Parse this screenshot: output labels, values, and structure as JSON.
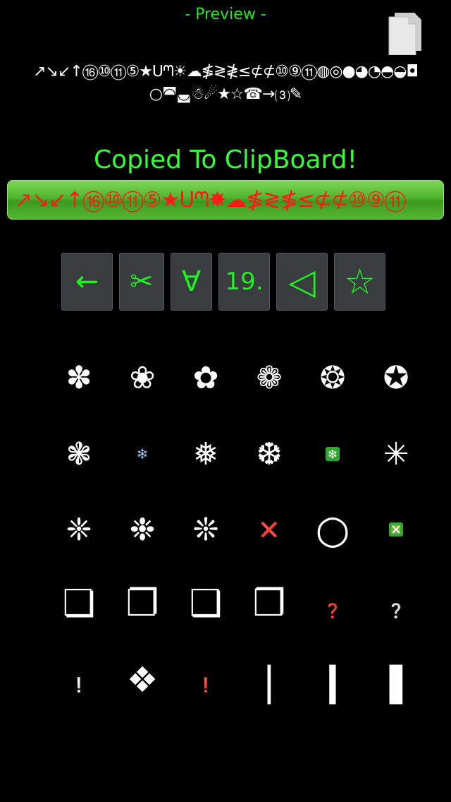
{
  "header": {
    "title": "- Preview -"
  },
  "preview": {
    "text": "↗↘↙↑⑯⑩⑪⑤★ᑌᘉ☀☁≸≷≹≤⊄⊄⑩⑨⑪◍◎●◕◔◓◒◘○◚◛☃☄★☆☎→⑶✎"
  },
  "status": {
    "copied": "Copied To ClipBoard!"
  },
  "output": {
    "text": "↗↘↙↑⑯⑩⑪⑤★ᑌᘉ✸☁≸≷≸≤⊄⊄⑩⑨⑪"
  },
  "toolbar": {
    "back": "←",
    "cut": "✂",
    "forall": "∀",
    "counter": "19.",
    "triangle": "◁",
    "star": "☆"
  },
  "symbols": [
    "✽",
    "❀",
    "✿",
    "❁",
    "❂",
    "✪",
    "❃",
    "❄",
    "❅",
    "❆",
    "❇",
    "✳",
    "❈",
    "❉",
    "❊",
    "❌",
    "○",
    "❎",
    "❏",
    "❐",
    "❑",
    "❒",
    "❓",
    "❔",
    "❕",
    "❖",
    "❗",
    "❘",
    "❙",
    "❚"
  ],
  "colors": {
    "accent": "#22e622",
    "output_text": "#ff1a1a",
    "bar_green": "#4fb32d",
    "button_bg": "#3a3d40"
  }
}
